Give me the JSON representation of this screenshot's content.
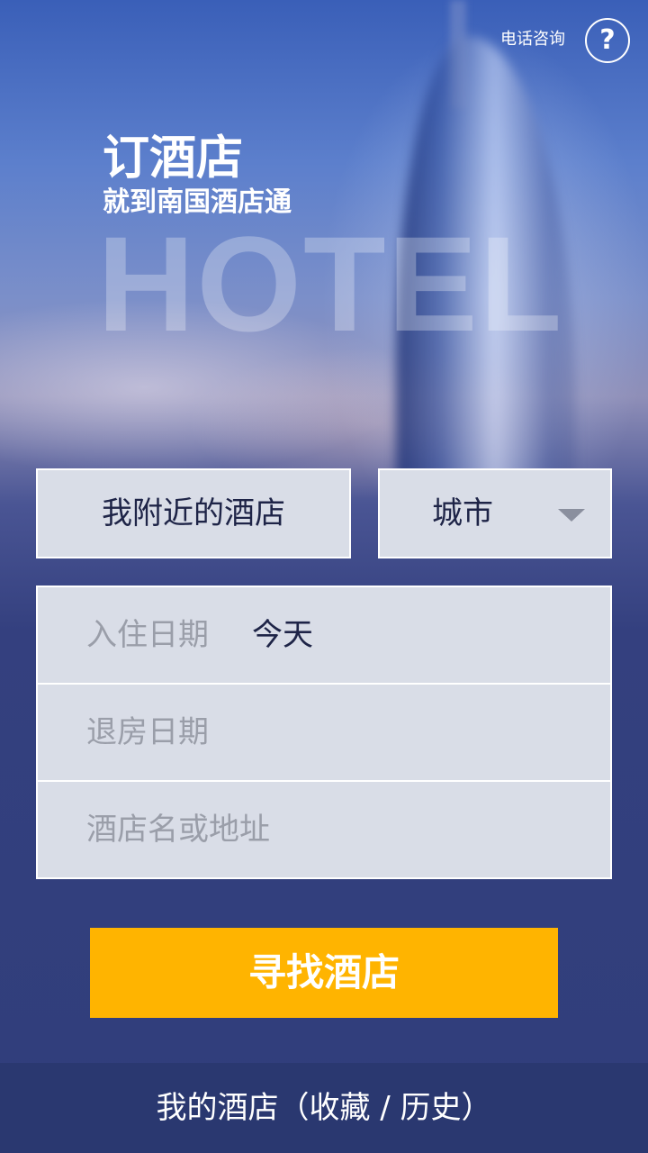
{
  "header": {
    "phone_consult": "电话咨询",
    "help_symbol": "?"
  },
  "hero": {
    "slogan_main": "订酒店",
    "slogan_sub": "就到南国酒店通",
    "watermark": "HOTEL"
  },
  "location": {
    "nearby_label": "我附近的酒店",
    "city_label": "城市"
  },
  "form": {
    "checkin_label": "入住日期",
    "checkin_value": "今天",
    "checkout_label": "退房日期",
    "checkout_value": "",
    "search_placeholder": "酒店名或地址"
  },
  "actions": {
    "search_button": "寻找酒店"
  },
  "footer": {
    "my_hotels": "我的酒店（收藏 / 历史）"
  },
  "colors": {
    "accent": "#ffb400",
    "background": "#2f3e7a",
    "field_bg": "#d9dde7",
    "text_dark": "#1e2447",
    "placeholder": "#9a9ea9"
  }
}
